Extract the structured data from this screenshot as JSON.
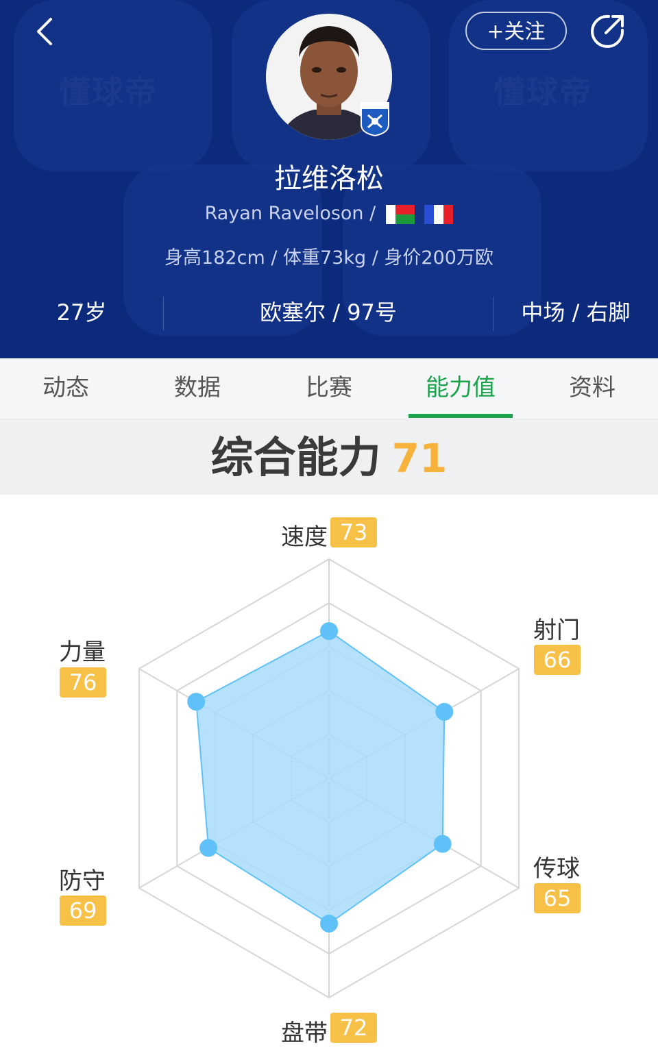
{
  "header": {
    "watermark": "懂球帝",
    "follow_label": "+关注",
    "player_name": "拉维洛松",
    "english_name": "Rayan Raveloson /",
    "flags": [
      "Madagascar",
      "France"
    ],
    "physical": "身高182cm / 体重73kg / 身价200万欧",
    "age": "27岁",
    "club_number": "欧塞尔 / 97号",
    "position_foot": "中场 / 右脚",
    "badge_text": "AJ AUXERRE"
  },
  "tabs": [
    {
      "label": "动态"
    },
    {
      "label": "数据"
    },
    {
      "label": "比赛"
    },
    {
      "label": "能力值",
      "active": true
    },
    {
      "label": "资料"
    }
  ],
  "overall": {
    "label": "综合能力",
    "value": "71"
  },
  "attributes": [
    {
      "name": "速度",
      "value": "73"
    },
    {
      "name": "射门",
      "value": "66"
    },
    {
      "name": "传球",
      "value": "65"
    },
    {
      "name": "盘带",
      "value": "72"
    },
    {
      "name": "防守",
      "value": "69"
    },
    {
      "name": "力量",
      "value": "76"
    }
  ],
  "colors": {
    "header_bg": "#0c2a7c",
    "active_tab": "#1aa34a",
    "value_badge": "#f7c046",
    "radar_fill": "#a8dcfb",
    "radar_point": "#5fc1f7"
  }
}
